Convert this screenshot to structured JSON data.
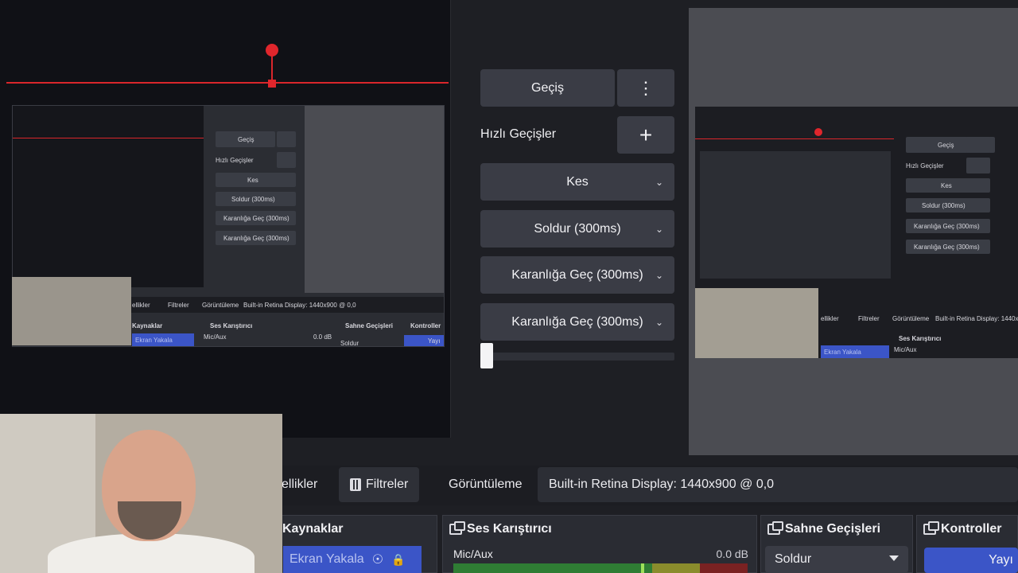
{
  "transitions": {
    "main_button": "Geçiş",
    "menu_icon": "vertical-dots-icon",
    "quick_title": "Hızlı Geçişler",
    "add_icon": "plus-icon",
    "items": [
      "Kes",
      "Soldur (300ms)",
      "Karanlığa Geç (300ms)",
      "Karanlığa Geç (300ms)"
    ]
  },
  "mini": {
    "gecis": "Geçiş",
    "hizli": "Hızlı Geçişler",
    "items": [
      "Kes",
      "Soldur (300ms)",
      "Karanlığa Geç (300ms)",
      "Karanlığa Geç (300ms)"
    ],
    "tabs": [
      "ellikler",
      "Filtreler",
      "Görüntüleme",
      "Built-in Retina Display: 1440x900 @ 0,0"
    ],
    "docks": [
      "Kaynaklar",
      "Ses Karıştırıcı",
      "Sahne Geçişleri",
      "Kontroller"
    ],
    "source": "Ekran Yakala",
    "mic": "Mic/Aux",
    "db": "0.0 dB",
    "select": "Soldur",
    "stream": "Yayı"
  },
  "dock_tabs": {
    "properties": "ellikler",
    "filters": "Filtreler",
    "display_label": "Görüntüleme",
    "display_value": "Built-in Retina Display: 1440x900 @ 0,0"
  },
  "docks": {
    "sources": {
      "title": "Kaynaklar",
      "item": "Ekran Yakala"
    },
    "mixer": {
      "title": "Ses Karıştırıcı",
      "channel": "Mic/Aux",
      "level": "0.0 dB"
    },
    "transitions": {
      "title": "Sahne Geçişleri",
      "selected": "Soldur"
    },
    "controls": {
      "title": "Kontroller",
      "stream_button": "Yayı"
    }
  },
  "colors": {
    "accent_blue": "#3b55c7",
    "red_marker": "#e0262c",
    "panel": "#3a3c45",
    "background": "#1e1f24"
  }
}
